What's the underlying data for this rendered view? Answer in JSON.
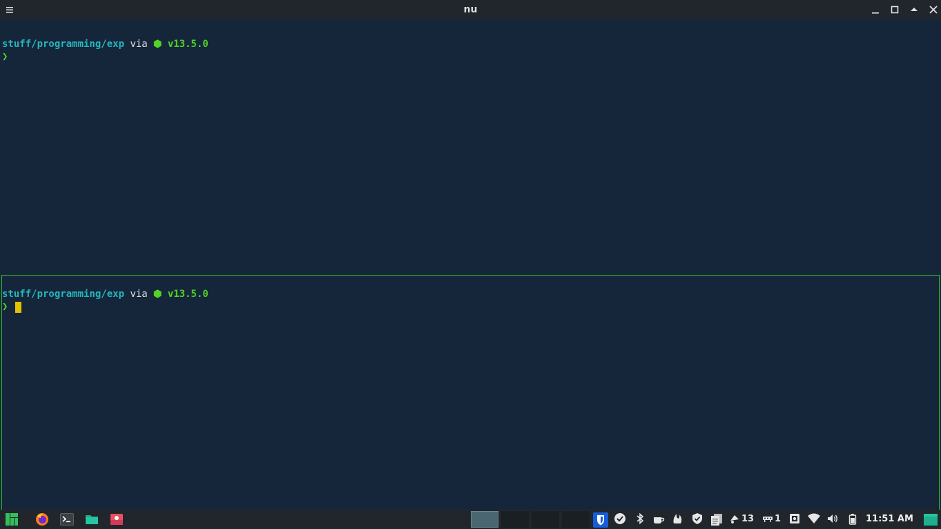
{
  "window": {
    "title": "nu",
    "menu_icon": "hamburger-menu-icon",
    "controls": [
      "minimize-icon",
      "maximize-icon",
      "keep-above-icon",
      "close-icon"
    ]
  },
  "terminal": {
    "top_pane": {
      "path": "stuff/programming/exp",
      "via": " via ",
      "node_version": "⬢ v13.5.0",
      "prompt_char": "❯"
    },
    "bottom_pane": {
      "path": "stuff/programming/exp",
      "via": " via ",
      "node_version": "⬢ v13.5.0",
      "prompt_char": "❯",
      "focused_border_color": "#2fbf2f",
      "cursor_color": "#e3c200"
    }
  },
  "taskbar": {
    "launchers": [
      "manjaro-menu-icon",
      "firefox-icon",
      "terminal-icon",
      "file-manager-icon",
      "screenshot-app-icon"
    ],
    "workspaces": [
      {
        "active": true
      },
      {
        "active": false
      },
      {
        "active": false
      },
      {
        "active": false
      }
    ],
    "tray": {
      "notifications_count": "13",
      "network_count": "1",
      "clock": "11:51 AM"
    }
  },
  "colors": {
    "background": "#16263a",
    "path": "#26b6be",
    "prompt_green": "#4fd326",
    "titlebar": "#20262c"
  }
}
